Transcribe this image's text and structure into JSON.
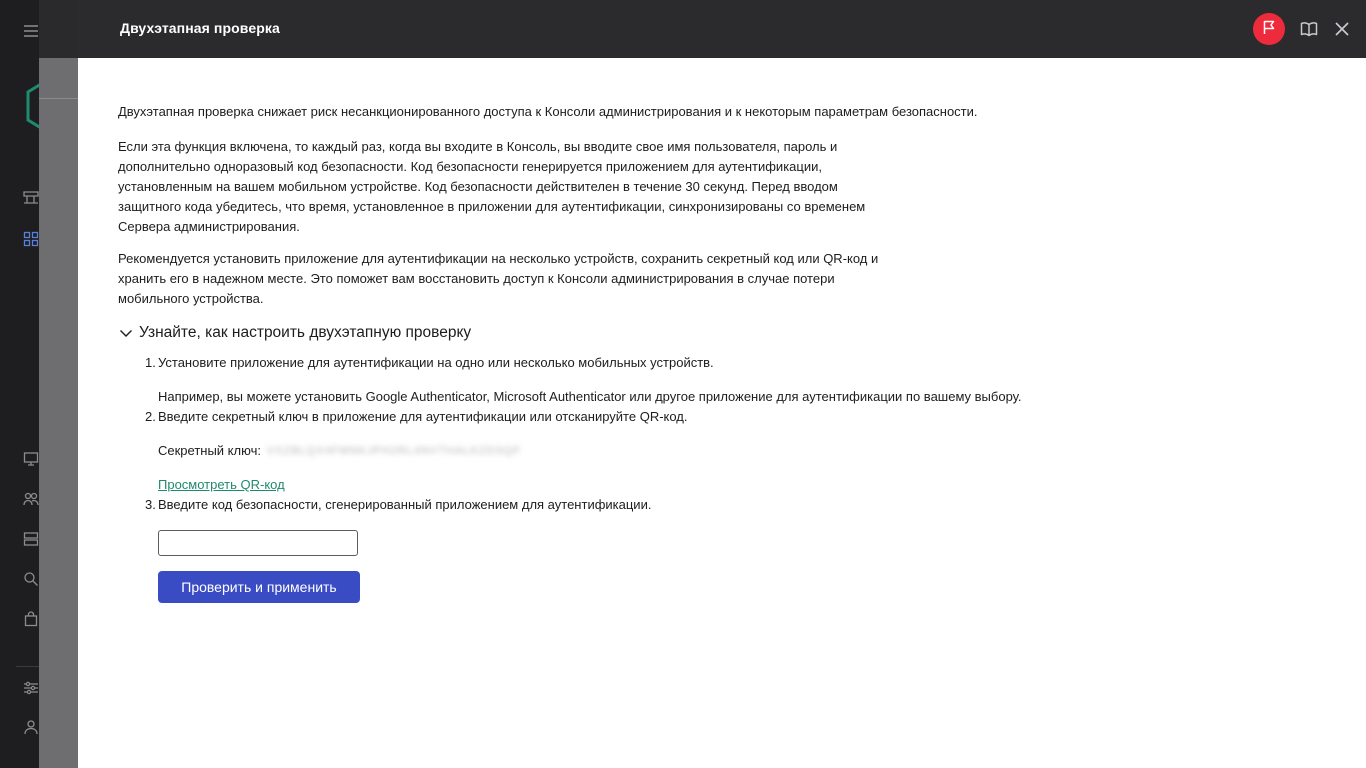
{
  "drawer": {
    "title": "Двухэтапная проверка"
  },
  "content": {
    "intro": "Двухэтапная проверка снижает риск несанкционированного доступа к Консоли администрирования и к некоторым параметрам безопасности.",
    "paragraph2": "Если эта функция включена, то каждый раз, когда вы входите в Консоль, вы вводите свое имя пользователя, пароль и дополнительно одноразовый код безопасности. Код безопасности генерируется приложением для аутентификации, установленным на вашем мобильном устройстве. Код безопасности действителен в течение 30 секунд. Перед вводом защитного кода убедитесь, что время, установленное в приложении для аутентификации, синхронизированы со временем Сервера администрирования.",
    "paragraph3": "Рекомендуется установить приложение для аутентификации на несколько устройств, сохранить секретный код или QR-код и хранить его в надежном месте. Это поможет вам восстановить доступ к Консоли администрирования в случае потери мобильного устройства.",
    "expander_label": "Узнайте, как настроить двухэтапную проверку",
    "steps": [
      {
        "number": "1.",
        "text": "Установите приложение для аутентификации на одно или несколько мобильных устройств.",
        "sub": "Например, вы можете установить Google Authenticator, Microsoft Authenticator или другое приложение для аутентификации по вашему выбору."
      },
      {
        "number": "2.",
        "text": "Введите секретный ключ в приложение для аутентификации или отсканируйте QR-код.",
        "secret_label": "Секретный ключ:",
        "secret_value": "VXZBLQX4FMNKJPH2RL4NVTHALKZDSQF",
        "qr_link": "Просмотреть QR-код"
      },
      {
        "number": "3.",
        "text": "Введите код безопасности, сгенерированный приложением для аутентификации."
      }
    ],
    "code_input_value": "",
    "verify_button": "Проверить и применить"
  },
  "colors": {
    "header_bg": "#2b2b2d",
    "flag_button": "#ed2b3c",
    "primary_button": "#3a4cc4",
    "link": "#1f8a6e"
  },
  "icons": {
    "header": [
      "flag-icon",
      "book-icon",
      "close-icon"
    ],
    "background_sidebar": [
      "menu-icon",
      "logo-icon",
      "dashboard-icon",
      "apps-icon",
      "monitor-icon",
      "users-icon",
      "server-icon",
      "search-icon",
      "bag-icon",
      "settings-icon",
      "user-icon"
    ]
  }
}
